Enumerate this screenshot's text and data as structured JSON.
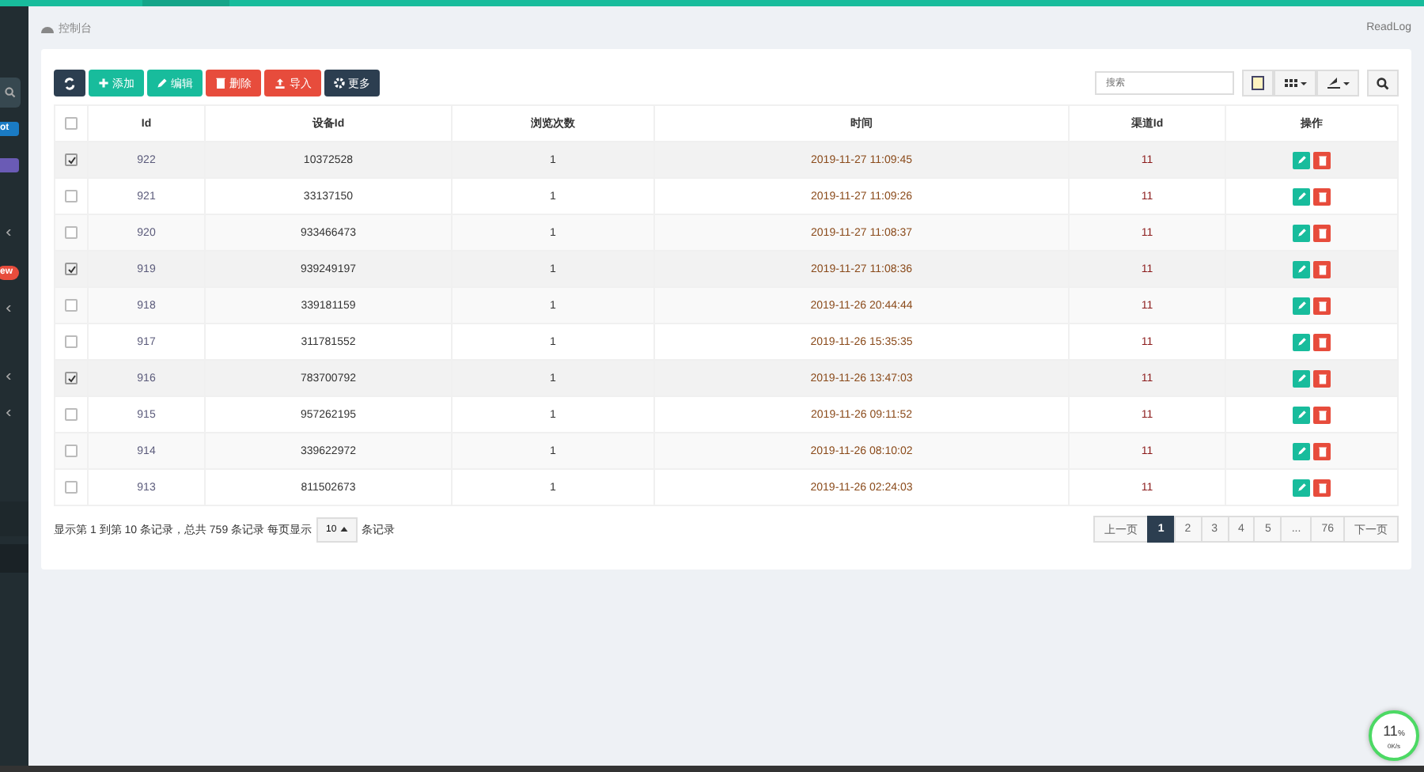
{
  "sidebar": {
    "badges": [
      {
        "text": "ot",
        "color": "#1a7bc4"
      },
      {
        "color": "#6a5bb5"
      },
      {
        "text": "ew",
        "color": "#e74c3c"
      }
    ]
  },
  "breadcrumb": {
    "title": "控制台",
    "right_link": "ReadLog"
  },
  "toolbar": {
    "buttons": [
      {
        "kind": "refresh",
        "color": "#2c3e50"
      },
      {
        "kind": "add",
        "label": "添加",
        "color": "#18bc9c"
      },
      {
        "kind": "edit",
        "label": "编辑",
        "color": "#18bc9c"
      },
      {
        "kind": "delete",
        "label": "删除",
        "color": "#e74c3c"
      },
      {
        "kind": "import",
        "label": "导入",
        "color": "#e74c3c"
      },
      {
        "kind": "more",
        "label": "更多",
        "color": "#2c3e50"
      }
    ],
    "search": {
      "placeholder": "搜索"
    }
  },
  "table": {
    "all_checked": false,
    "columns": [
      "Id",
      "设备Id",
      "浏览次数",
      "时间",
      "渠道Id",
      "操作"
    ],
    "rows": [
      {
        "checked": true,
        "cells": [
          "922",
          "10372528",
          "1",
          "2019-11-27 11:09:45",
          "11"
        ]
      },
      {
        "checked": false,
        "cells": [
          "921",
          "33137150",
          "1",
          "2019-11-27 11:09:26",
          "11"
        ]
      },
      {
        "checked": false,
        "cells": [
          "920",
          "933466473",
          "1",
          "2019-11-27 11:08:37",
          "11"
        ]
      },
      {
        "checked": true,
        "cells": [
          "919",
          "939249197",
          "1",
          "2019-11-27 11:08:36",
          "11"
        ]
      },
      {
        "checked": false,
        "cells": [
          "918",
          "339181159",
          "1",
          "2019-11-26 20:44:44",
          "11"
        ]
      },
      {
        "checked": false,
        "cells": [
          "917",
          "311781552",
          "1",
          "2019-11-26 15:35:35",
          "11"
        ]
      },
      {
        "checked": true,
        "cells": [
          "916",
          "783700792",
          "1",
          "2019-11-26 13:47:03",
          "11"
        ]
      },
      {
        "checked": false,
        "cells": [
          "915",
          "957262195",
          "1",
          "2019-11-26 09:11:52",
          "11"
        ]
      },
      {
        "checked": false,
        "cells": [
          "914",
          "339622972",
          "1",
          "2019-11-26 08:10:02",
          "11"
        ]
      },
      {
        "checked": false,
        "cells": [
          "913",
          "811502673",
          "1",
          "2019-11-26 02:24:03",
          "11"
        ]
      }
    ]
  },
  "footer": {
    "summary": "显示第 1 到第 10 条记录，总共 759 条记录 每页显示",
    "page_size": "10",
    "suffix": "条记录"
  },
  "pagination": [
    {
      "label": "上一页",
      "selected": false
    },
    {
      "label": "1",
      "selected": true
    },
    {
      "label": "2",
      "selected": false
    },
    {
      "label": "3",
      "selected": false
    },
    {
      "label": "4",
      "selected": false
    },
    {
      "label": "5",
      "selected": false
    },
    {
      "label": "...",
      "selected": false
    },
    {
      "label": "76",
      "selected": false
    },
    {
      "label": "下一页",
      "selected": false
    }
  ],
  "speed_widget": {
    "percent": "11",
    "unit": "%",
    "rate": "0K/s"
  }
}
